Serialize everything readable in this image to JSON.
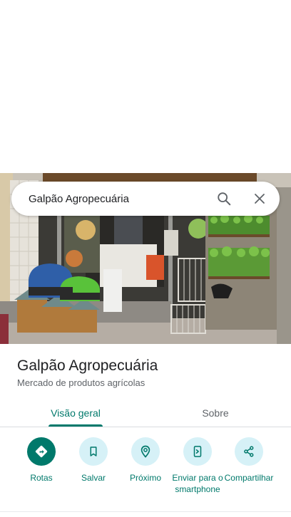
{
  "search": {
    "query": "Galpão Agropecuária"
  },
  "place": {
    "name": "Galpão Agropecuária",
    "category": "Mercado de produtos agrícolas"
  },
  "tabs": [
    {
      "label": "Visão geral",
      "selected": true
    },
    {
      "label": "Sobre",
      "selected": false
    }
  ],
  "actions": [
    {
      "label": "Rotas",
      "icon": "directions-icon",
      "primary": true
    },
    {
      "label": "Salvar",
      "icon": "bookmark-icon",
      "primary": false
    },
    {
      "label": "Próximo",
      "icon": "nearby-icon",
      "primary": false
    },
    {
      "label": "Enviar para o smartphone",
      "icon": "send-to-phone-icon",
      "primary": false
    },
    {
      "label": "Compartilhar",
      "icon": "share-icon",
      "primary": false
    }
  ],
  "colors": {
    "accent": "#00796b",
    "action_bg": "#d6f1f7",
    "text_primary": "#202124",
    "text_secondary": "#5f6368"
  }
}
